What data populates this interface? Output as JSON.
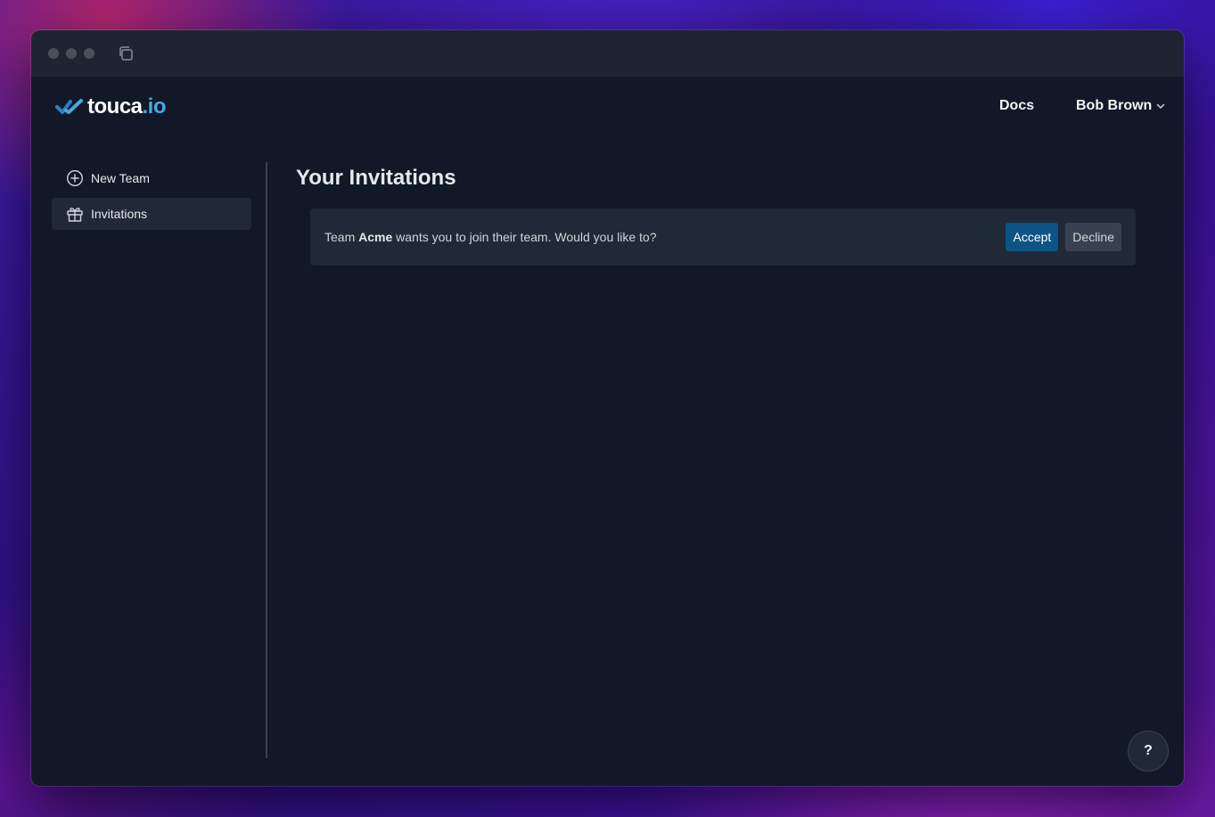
{
  "app": {
    "logo_main": "touca",
    "logo_tld": ".io"
  },
  "header": {
    "docs_label": "Docs",
    "user_name": "Bob Brown"
  },
  "sidebar": {
    "items": [
      {
        "label": "New Team",
        "icon": "plus-circle-icon",
        "active": false
      },
      {
        "label": "Invitations",
        "icon": "gift-icon",
        "active": true
      }
    ]
  },
  "main": {
    "title": "Your Invitations",
    "invitations": [
      {
        "prefix": "Team",
        "team_name": "Acme",
        "suffix": "wants you to join their team. Would you like to?",
        "accept_label": "Accept",
        "decline_label": "Decline"
      }
    ]
  },
  "help": {
    "label": "?"
  },
  "colors": {
    "window_bg": "#111827",
    "card_bg": "#1f2937",
    "accent": "#0c5483",
    "logo_accent": "#4aa8e0"
  }
}
